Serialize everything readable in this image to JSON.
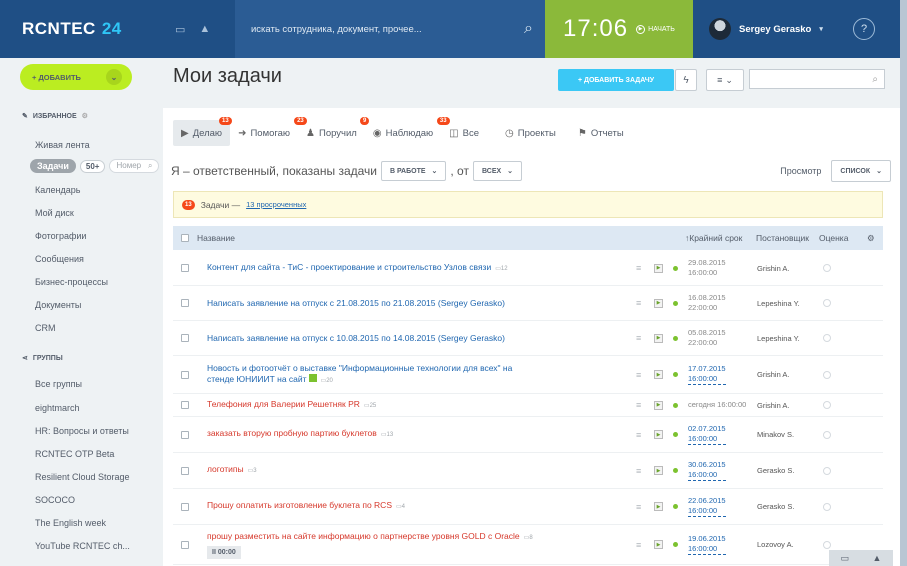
{
  "header": {
    "logo": "RCNTEC",
    "logo_num": "24",
    "search_placeholder": "искать сотрудника, документ, прочее...",
    "time": "17:06",
    "start_label": "НАЧАТЬ",
    "user_name": "Sergey Gerasko",
    "help": "?"
  },
  "sidebar": {
    "add_label": "+ ДОБАВИТЬ",
    "favorites_label": "ИЗБРАННОЕ",
    "feed": "Живая лента",
    "tasks": "Задачи",
    "tasks_count": "50+",
    "tasks_search_placeholder": "Номер",
    "calendar": "Календарь",
    "disk": "Мой диск",
    "photos": "Фотографии",
    "messages": "Сообщения",
    "bp": "Бизнес-процессы",
    "docs": "Документы",
    "crm": "CRM",
    "groups_label": "ГРУППЫ",
    "all_groups": "Все группы",
    "g1": "eightmarch",
    "g2": "HR: Вопросы и ответы",
    "g3": "RCNTEC OTP Beta",
    "g4": "Resilient Cloud Storage",
    "g5": "SOCOCO",
    "g6": "The English week",
    "g7": "YouTube RCNTEC ch..."
  },
  "main": {
    "title": "Мои задачи",
    "add_task": "+ ДОБАВИТЬ ЗАДАЧУ",
    "tabs": [
      {
        "label": "Делаю",
        "badge": "13"
      },
      {
        "label": "Помогаю",
        "badge": "23"
      },
      {
        "label": "Поручил",
        "badge": "9"
      },
      {
        "label": "Наблюдаю",
        "badge": "33"
      },
      {
        "label": "Все",
        "badge": ""
      },
      {
        "label": "Проекты",
        "badge": ""
      },
      {
        "label": "Отчеты",
        "badge": ""
      }
    ],
    "filter_text": "Я – ответственный, показаны задачи",
    "filter_status": "В РАБОТЕ",
    "filter_from": ", от",
    "filter_all": "ВСЕХ",
    "view_label": "Просмотр",
    "view_value": "СПИСОК",
    "overdue_badge": "13",
    "overdue_text": "Задачи —",
    "overdue_link": "13 просроченных",
    "col_name": "Название",
    "col_deadline": "↑Крайний срок",
    "col_owner": "Постановщик",
    "col_rating": "Оценка"
  },
  "rows": [
    {
      "title": "Контент для сайта - ТиС - проектирование и строительство Узлов связи",
      "cmt": "12",
      "date1": "29.08.2015",
      "date2": "16:00:00",
      "owner": "Grishin A."
    },
    {
      "title": "Написать заявление на отпуск с 21.08.2015 по 21.08.2015 (Sergey Gerasko)",
      "cmt": "",
      "date1": "16.08.2015",
      "date2": "22:00:00",
      "owner": "Lepeshina Y."
    },
    {
      "title": "Написать заявление на отпуск с 10.08.2015 по 14.08.2015 (Sergey Gerasko)",
      "cmt": "",
      "date1": "05.08.2015",
      "date2": "22:00:00",
      "owner": "Lepeshina Y."
    },
    {
      "title": "Новость и фотоотчёт о выставке \"Информационные технологии для всех\" на",
      "title2": "стенде ЮНИИИТ на сайт",
      "cmt": "20",
      "date1": "17.07.2015",
      "date2": "16:00:00",
      "owner": "Grishin A."
    },
    {
      "title": "Телефония для Валерии Решетняк PR",
      "cmt": "25",
      "date1": "сегодня 16:00:00",
      "date2": "",
      "owner": "Grishin A."
    },
    {
      "title": "заказать вторую пробную партию буклетов",
      "cmt": "13",
      "date1": "02.07.2015",
      "date2": "16:00:00",
      "owner": "Minakov S."
    },
    {
      "title": "логотипы",
      "cmt": "3",
      "date1": "30.06.2015",
      "date2": "16:00:00",
      "owner": "Gerasko S."
    },
    {
      "title": "Прошу оплатить изготовление буклета по RCS",
      "cmt": "4",
      "date1": "22.06.2015",
      "date2": "16:00:00",
      "owner": "Gerasko S."
    },
    {
      "title": "прошу разместить на сайте информацию о партнерстве уровня GOLD с Oracle",
      "cmt": "8",
      "timer": "II 00:00",
      "date1": "19.06.2015",
      "date2": "16:00:00",
      "owner": "Lozovoy A."
    }
  ]
}
